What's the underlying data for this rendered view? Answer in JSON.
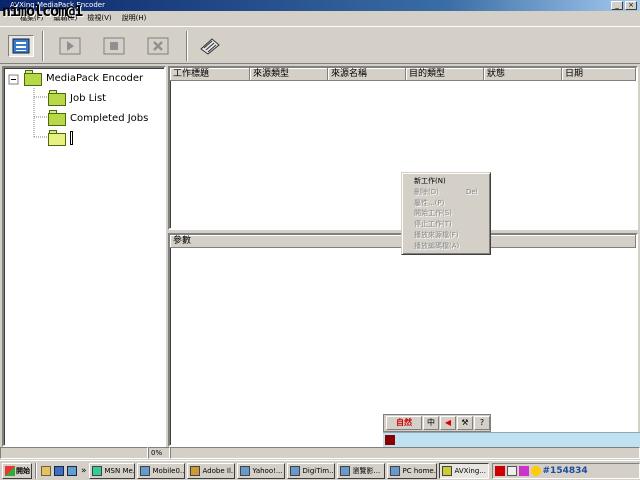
{
  "window": {
    "title": "AVXing MediaPack Encoder"
  },
  "watermark": "nimolcom@1",
  "menu": [
    "檔案(F)",
    "編輯(E)",
    "檢視(V)",
    "說明(H)"
  ],
  "toolbar": {
    "buttons": [
      {
        "name": "job-list-icon"
      },
      {
        "name": "play-icon"
      },
      {
        "name": "stop-icon"
      },
      {
        "name": "cancel-icon"
      },
      {
        "name": "encode-icon"
      }
    ]
  },
  "tree": {
    "root": "MediaPack Encoder",
    "children": [
      "Job List",
      "Completed Jobs",
      ""
    ]
  },
  "jobs_table": {
    "columns": [
      "工作標題",
      "來源類型",
      "來源名稱",
      "目的類型",
      "狀態",
      "日期"
    ]
  },
  "params_panel": {
    "header": "參數"
  },
  "context_menu": {
    "items": [
      {
        "label": "新工作(N)",
        "shortcut": "",
        "enabled": true
      },
      {
        "label": "刪除(D)",
        "shortcut": "Del",
        "enabled": false
      },
      {
        "label": "屬性...(P)",
        "shortcut": "",
        "enabled": false
      },
      {
        "label": "開始工作(S)",
        "shortcut": "",
        "enabled": false
      },
      {
        "label": "停止工作(T)",
        "shortcut": "",
        "enabled": false
      },
      {
        "label": "播放來源檔(F)",
        "shortcut": "",
        "enabled": false
      },
      {
        "label": "播放編碼檔(A)",
        "shortcut": "",
        "enabled": false
      }
    ]
  },
  "statusbar": {
    "progress": "0%"
  },
  "ime": {
    "label": "自然"
  },
  "taskbar": {
    "start": "開始",
    "items": [
      {
        "label": "MSN Me...",
        "active": false
      },
      {
        "label": "Mobile0...",
        "active": false
      },
      {
        "label": "Adobe Il...",
        "active": false
      },
      {
        "label": "Yahoo!...",
        "active": false
      },
      {
        "label": "DigiTim...",
        "active": false
      },
      {
        "label": "瀏覽影...",
        "active": false
      },
      {
        "label": "PC home...",
        "active": false
      },
      {
        "label": "AVXing...",
        "active": true
      }
    ],
    "tray_text": "#154834"
  }
}
